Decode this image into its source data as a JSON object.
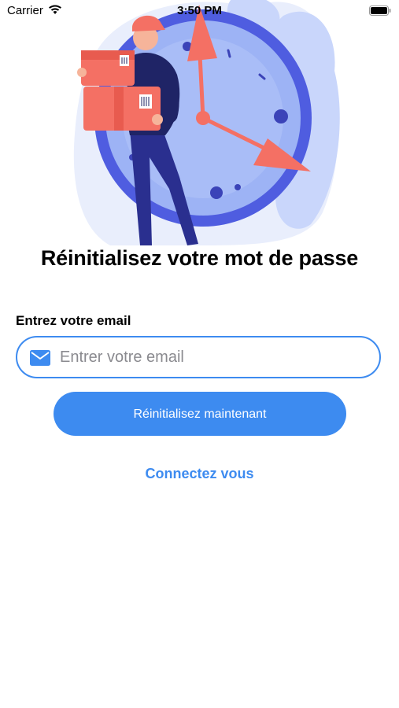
{
  "status_bar": {
    "carrier": "Carrier",
    "time": "3:50 PM",
    "wifi_icon": "wifi-icon",
    "battery_icon": "battery-icon"
  },
  "illustration": {
    "description_icon": "delivery-clock-illustration",
    "colors": {
      "blob": "#c9d6fb",
      "clock_ring": "#4f5de0",
      "clock_face": "#9db3f5",
      "hands": "#f47064",
      "boxes": "#f47064",
      "person": "#2a2f8f"
    }
  },
  "title": "Réinitialisez votre mot de passe",
  "form": {
    "email_label": "Entrez votre email",
    "email_value": "",
    "email_placeholder": "Entrer votre email",
    "mail_icon": "mail-icon",
    "submit_label": "Réinitialisez maintenant"
  },
  "login_link": "Connectez vous",
  "colors": {
    "accent": "#3d8bf0",
    "text": "#000000",
    "placeholder": "#8a8a8f"
  }
}
